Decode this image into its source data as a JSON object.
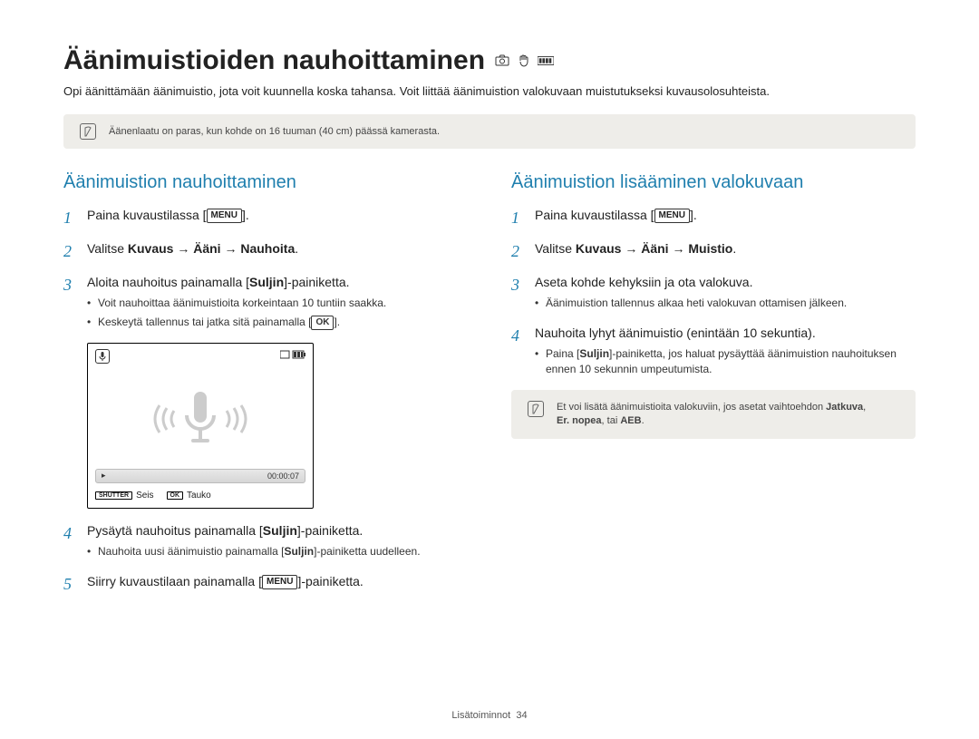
{
  "title": "Äänimuistioiden nauhoittaminen",
  "subtitle": "Opi äänittämään äänimuistio, jota voit kuunnella koska tahansa. Voit liittää äänimuistion valokuvaan muistutukseksi kuvausolosuhteista.",
  "title_mode_icons": [
    "camera-auto-icon",
    "hand-icon",
    "scene-icon"
  ],
  "top_note": "Äänenlaatu on paras, kun kohde on 16 tuuman (40 cm) päässä kamerasta.",
  "left": {
    "heading": "Äänimuistion nauhoittaminen",
    "steps": [
      {
        "num": "1",
        "pre": "Paina kuvaustilassa [",
        "key": "MENU",
        "post": "]."
      },
      {
        "num": "2",
        "html_parts": [
          "Valitse ",
          "Kuvaus",
          " → ",
          "Ääni",
          " → ",
          "Nauhoita",
          "."
        ]
      },
      {
        "num": "3",
        "pre": "Aloita nauhoitus painamalla [",
        "bold": "Suljin",
        "post": "]-painiketta.",
        "sub": [
          "Voit nauhoittaa äänimuistioita korkeintaan 10 tuntiin saakka.",
          {
            "pre": "Keskeytä tallennus tai jatka sitä painamalla [",
            "key": "OK",
            "post": "]."
          }
        ]
      },
      {
        "num": "4",
        "pre": "Pysäytä nauhoitus painamalla [",
        "bold": "Suljin",
        "post": "]-painiketta.",
        "sub": [
          {
            "pre": "Nauhoita uusi äänimuistio painamalla [",
            "bold": "Suljin",
            "post": "]-painiketta uudelleen."
          }
        ]
      },
      {
        "num": "5",
        "pre": "Siirry kuvaustilaan painamalla [",
        "key": "MENU",
        "post": "]-painiketta."
      }
    ],
    "screen": {
      "timer": "00:00:07",
      "bottom_left_key": "SHUTTER",
      "bottom_left_label": "Seis",
      "bottom_right_key": "OK",
      "bottom_right_label": "Tauko"
    }
  },
  "right": {
    "heading": "Äänimuistion lisääminen valokuvaan",
    "steps": [
      {
        "num": "1",
        "pre": "Paina kuvaustilassa [",
        "key": "MENU",
        "post": "]."
      },
      {
        "num": "2",
        "html_parts": [
          "Valitse ",
          "Kuvaus",
          " → ",
          "Ääni",
          " → ",
          "Muistio",
          "."
        ]
      },
      {
        "num": "3",
        "text": "Aseta kohde kehyksiin ja ota valokuva.",
        "sub": [
          "Äänimuistion tallennus alkaa heti valokuvan ottamisen jälkeen."
        ]
      },
      {
        "num": "4",
        "text": "Nauhoita lyhyt äänimuistio (enintään 10 sekuntia).",
        "sub": [
          {
            "pre": "Paina [",
            "bold": "Suljin",
            "post": "]-painiketta, jos haluat pysäyttää äänimuistion nauhoituksen ennen 10 sekunnin umpeutumista."
          }
        ]
      }
    ],
    "note": {
      "line1_pre": "Et voi lisätä äänimuistioita valokuviin, jos asetat vaihtoehdon ",
      "line1_bold": "Jatkuva",
      "line1_post": ", ",
      "line2_bold1": "Er. nopea",
      "line2_mid": ", tai ",
      "line2_bold2": "AEB",
      "line2_post": "."
    }
  },
  "footer_label": "Lisätoiminnot",
  "footer_page": "34"
}
